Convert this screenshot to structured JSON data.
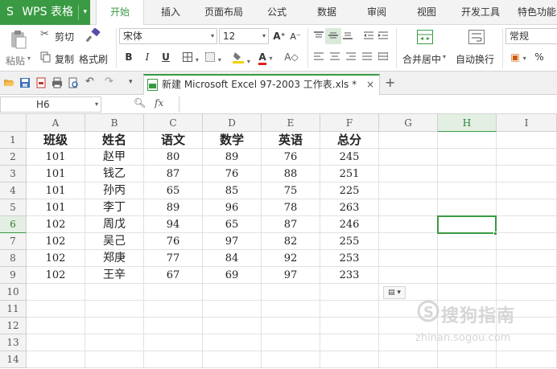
{
  "app": {
    "name": "WPS 表格",
    "logo_glyph": "S"
  },
  "menu": {
    "tabs": [
      {
        "label": "开始",
        "active": true
      },
      {
        "label": "插入"
      },
      {
        "label": "页面布局"
      },
      {
        "label": "公式"
      },
      {
        "label": "数据"
      },
      {
        "label": "审阅"
      },
      {
        "label": "视图"
      },
      {
        "label": "开发工具"
      },
      {
        "label": "特色功能"
      }
    ]
  },
  "ribbon": {
    "paste_label": "粘贴",
    "cut_label": "剪切",
    "copy_label": "复制",
    "format_painter_label": "格式刷",
    "font_name": "宋体",
    "font_size": "12",
    "grow_font": "A⁺",
    "shrink_font": "A⁻",
    "bold": "B",
    "italic": "I",
    "underline": "U",
    "merge_center_label": "合并居中",
    "wrap_text_label": "自动换行",
    "number_format": "常规",
    "percent": "%",
    "accent_color": "#3a9a43",
    "font_color": "#e02020",
    "fill_color": "#f5d000"
  },
  "quick_access": {
    "doc_tab_title": "新建 Microsoft Excel 97-2003 工作表.xls *",
    "close_glyph": "×",
    "new_tab_glyph": "+"
  },
  "formula_bar": {
    "cell_ref": "H6",
    "fx_label": "fx",
    "formula": ""
  },
  "sheet": {
    "columns": [
      "A",
      "B",
      "C",
      "D",
      "E",
      "F",
      "G",
      "H",
      "I"
    ],
    "rows": [
      "1",
      "2",
      "3",
      "4",
      "5",
      "6",
      "7",
      "8",
      "9",
      "10",
      "11",
      "12",
      "13",
      "14"
    ],
    "selected_cell": "H6",
    "header": [
      "班级",
      "姓名",
      "语文",
      "数学",
      "英语",
      "总分"
    ],
    "records": [
      [
        "101",
        "赵甲",
        "80",
        "89",
        "76",
        "245"
      ],
      [
        "101",
        "钱乙",
        "87",
        "76",
        "88",
        "251"
      ],
      [
        "101",
        "孙丙",
        "65",
        "85",
        "75",
        "225"
      ],
      [
        "101",
        "李丁",
        "89",
        "96",
        "78",
        "263"
      ],
      [
        "102",
        "周戊",
        "94",
        "65",
        "87",
        "246"
      ],
      [
        "102",
        "吴己",
        "76",
        "97",
        "82",
        "255"
      ],
      [
        "102",
        "郑庚",
        "77",
        "84",
        "92",
        "253"
      ],
      [
        "102",
        "王辛",
        "67",
        "69",
        "97",
        "233"
      ]
    ]
  },
  "watermark": {
    "text": "搜狗指南",
    "url": "zhinan.sogou.com"
  }
}
